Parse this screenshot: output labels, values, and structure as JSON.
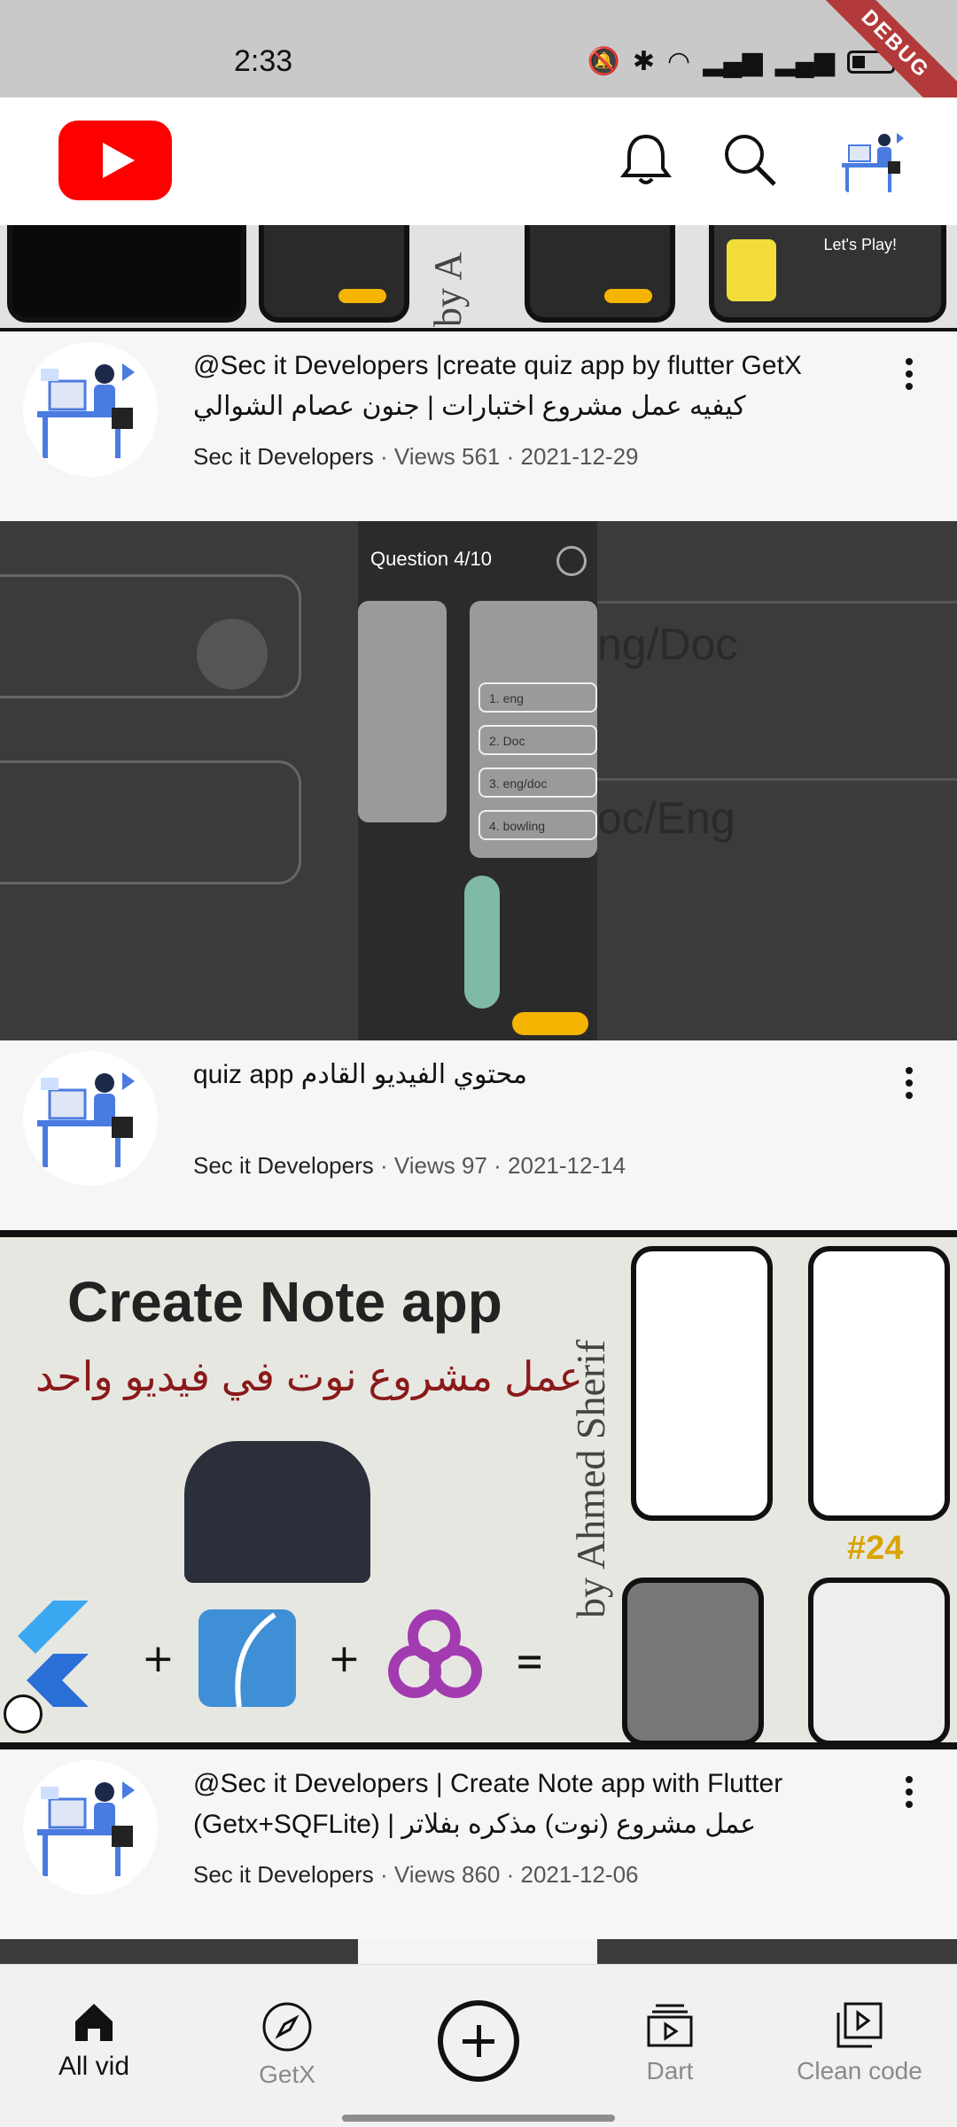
{
  "status_bar": {
    "time": "2:33",
    "debug_label": "DEBUG"
  },
  "top_bar": {
    "brand_color": "#ff0000"
  },
  "videos": [
    {
      "title_line1": "@Sec it Developers |create quiz app by flutter GetX",
      "title_line2": "كيفيه عمل مشروع اختبارات | جنون عصام الشوالي",
      "channel": "Sec it Developers",
      "views": "Views 561",
      "date": "2021-12-29"
    },
    {
      "title_line1": "quiz app محتوي الفيديو القادم",
      "title_line2": "",
      "channel": "Sec it Developers",
      "views": "Views 97",
      "date": "2021-12-14"
    },
    {
      "title_line1": "@Sec it Developers  | Create Note app with Flutter",
      "title_line2": "(Getx+SQFLite) | عمل مشروع (نوت) مذكره بفلاتر",
      "channel": "Sec it Developers",
      "views": "Views 860",
      "date": "2021-12-06"
    }
  ],
  "thumbnails": {
    "top_by": "by A",
    "top_lets_play": "Let's Play!",
    "quiz_question": "Question 4/10",
    "quiz_options": [
      "1. eng",
      "2. Doc",
      "3. eng/doc",
      "4. bowling"
    ],
    "quiz_overlay_1": "ng/Doc",
    "quiz_overlay_2": "oc/Eng",
    "note_title": "Create Note app",
    "note_subtitle_ar": "عمل مشروع نوت في فيديو واحد",
    "note_by": "by Ahmed Sherif",
    "note_episode": "#24"
  },
  "bottom_nav": [
    {
      "label": "All vid",
      "icon": "home-icon",
      "active": true
    },
    {
      "label": "GetX",
      "icon": "compass-icon",
      "active": false
    },
    {
      "label": "",
      "icon": "add-circle-icon",
      "active": false
    },
    {
      "label": "Dart",
      "icon": "subscriptions-icon",
      "active": false
    },
    {
      "label": "Clean code",
      "icon": "library-icon",
      "active": false
    }
  ]
}
